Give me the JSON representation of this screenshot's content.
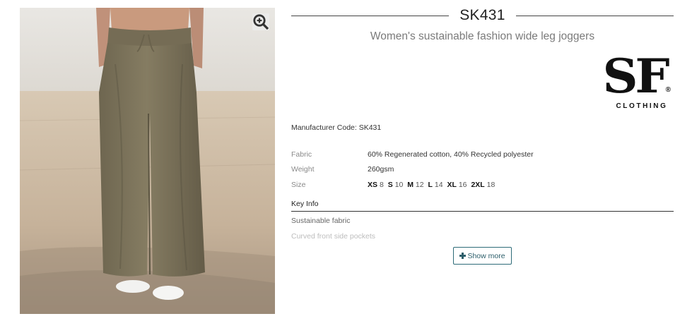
{
  "product": {
    "sku": "SK431",
    "subtitle": "Women's sustainable fashion wide leg joggers",
    "manufacturer_code_label": "Manufacturer Code: SK431",
    "image_alt": "Women's wide leg joggers in khaki worn by model"
  },
  "brand": {
    "mark": "SF",
    "registered": "®",
    "wordmark": "CLOTHING"
  },
  "specs": {
    "fabric": {
      "label": "Fabric",
      "value": "60% Regenerated cotton, 40% Recycled polyester"
    },
    "weight": {
      "label": "Weight",
      "value": "260gsm"
    },
    "size": {
      "label": "Size",
      "options": [
        {
          "code": "XS",
          "num": "8"
        },
        {
          "code": "S",
          "num": "10"
        },
        {
          "code": "M",
          "num": "12"
        },
        {
          "code": "L",
          "num": "14"
        },
        {
          "code": "XL",
          "num": "16"
        },
        {
          "code": "2XL",
          "num": "18"
        }
      ]
    }
  },
  "key_info": {
    "header": "Key Info",
    "items": [
      "Sustainable fabric",
      "Curved front side pockets"
    ],
    "show_more_label": "Show more"
  },
  "icons": {
    "zoom": "magnifier-plus-icon",
    "show_more": "plus-icon"
  },
  "colors": {
    "accent": "#2d6b78",
    "garment": "#7a7158"
  }
}
